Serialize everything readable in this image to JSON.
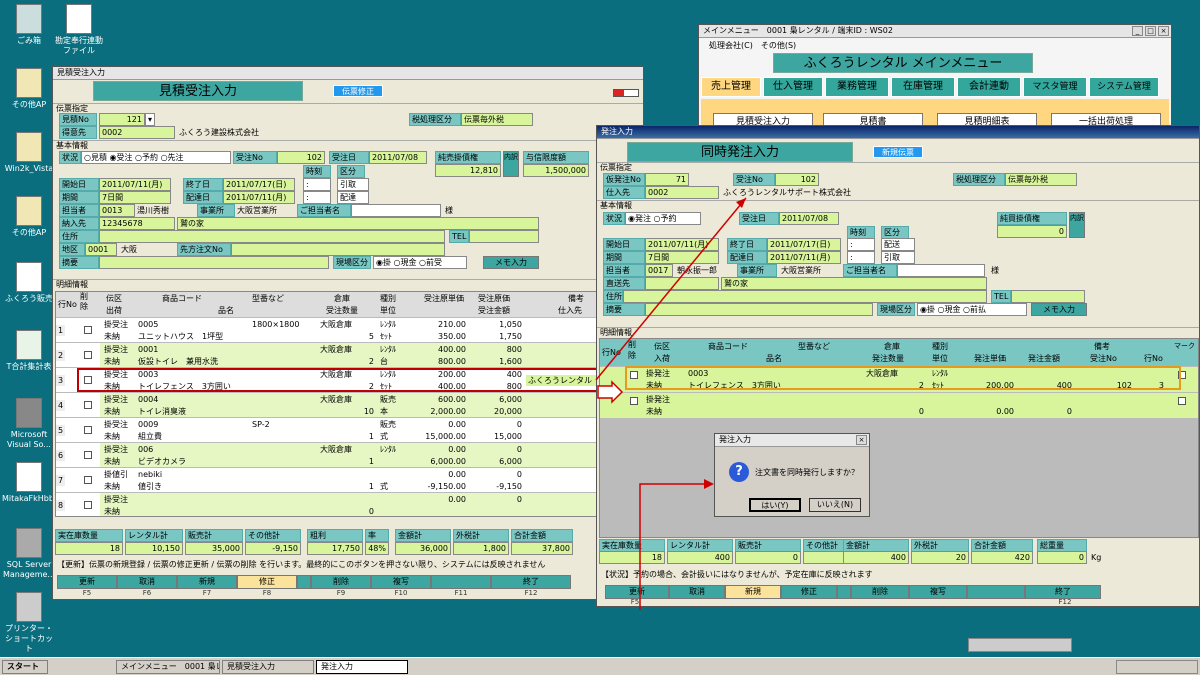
{
  "desktop": {
    "icons": [
      "ごみ箱",
      "勘定奉行連動ファイル",
      "その他AP",
      "Win2k_Vista",
      "その他AP",
      "ふくろう販売",
      "T合計集計表",
      "Microsoft Visual So...",
      "MitakaFkHbb...",
      "SQL Server Manageme...",
      "プリンター・ショートカット"
    ]
  },
  "est": {
    "title": "見積受注入力",
    "header": "見積受注入力",
    "badge": "伝票修正",
    "sec_denpyo": "伝票指定",
    "sec_kihon": "基本情報",
    "sec_meisai": "明細情報",
    "l_mitsumori": "見積No",
    "v_mitsumori": "121",
    "l_tokui": "得意先",
    "v_tokui_code": "0002",
    "v_tokui_name": "ふくろう建設株式会社",
    "l_zei": "税処理区分",
    "v_zei": "伝票毎外税",
    "l_jokyo": "状況",
    "jokyo_opts": "○見積 ◉受注 ○予約 ○先注",
    "l_juchu": "受注No",
    "v_juchu": "102",
    "l_juchubi": "受注日",
    "v_juchubi": "2011/07/08",
    "l_urikake": "純売掛債権",
    "v_urikake": "12,810",
    "btn_uchi": "内訳",
    "l_yoshin": "与信限度額",
    "v_yoshin": "1,500,000",
    "l_jikoku": "時刻",
    "l_kubun": "区分",
    "l_kaishi": "開始日",
    "v_kaishi": "2011/07/11(月)",
    "l_shuryo": "終了日",
    "v_shuryo": "2011/07/17(日)",
    "v_k1": "引取",
    "l_kikan": "期間",
    "v_kikan": "7日間",
    "l_haitatsu": "配達日",
    "v_haitatsu": "2011/07/11(月)",
    "v_k2": "配達",
    "l_tanto": "担当者",
    "v_tanto_code": "0013",
    "v_tanto_name": "湯川秀樹",
    "l_jigyo": "事業所",
    "v_jigyo": "大阪営業所",
    "l_gotanto": "ご担当者名",
    "v_sama": "様",
    "l_nonyu": "納入先",
    "v_nonyu_code": "12345678",
    "v_nonyu_name": "鷲の家",
    "l_jusho": "住所",
    "l_tel": "TEL",
    "l_chiku": "地区",
    "v_chiku_code": "0001",
    "v_chiku": "大阪",
    "l_saki": "先方注文No",
    "l_tekiyo": "摘要",
    "l_genba": "現場区分",
    "genba_opts": "◉掛 ○現金 ○前受",
    "btn_memo": "メモ入力",
    "cols": {
      "gyo": "行No",
      "sakujo": "削除",
      "denku": "伝区",
      "shoka": "出荷",
      "code": "商品コード",
      "hinmei": "品名",
      "kata": "型番など",
      "soko": "倉庫",
      "suryo": "受注数量",
      "shubetsu": "種別",
      "tani": "単位",
      "tanka": "受注原単価",
      "kin": "受注原価",
      "kingaku": "受注金額",
      "biko": "備考",
      "shiire": "仕入先"
    },
    "rows": [
      {
        "no": "1",
        "denku": "掛受注",
        "shoka": "未納",
        "code": "0005",
        "hinmei": "ユニットハウス　1坪型",
        "kata": "1800×1800",
        "soko": "大阪倉庫",
        "suryo": "5",
        "shubetsu": "ﾚﾝﾀﾙ",
        "tani": "ｾｯﾄ",
        "tanka1": "210.00",
        "tanka2": "350.00",
        "kin1": "1,050",
        "kin2": "1,750",
        "biko": ""
      },
      {
        "no": "2",
        "denku": "掛受注",
        "shoka": "未納",
        "code": "0001",
        "hinmei": "仮設トイレ　兼用水洗",
        "kata": "",
        "soko": "大阪倉庫",
        "suryo": "2",
        "shubetsu": "ﾚﾝﾀﾙ",
        "tani": "台",
        "tanka1": "400.00",
        "tanka2": "800.00",
        "kin1": "800",
        "kin2": "1,600",
        "biko": ""
      },
      {
        "no": "3",
        "denku": "掛受注",
        "shoka": "未納",
        "code": "0003",
        "hinmei": "トイレフェンス　3方囲い",
        "kata": "",
        "soko": "大阪倉庫",
        "suryo": "2",
        "shubetsu": "ﾚﾝﾀﾙ",
        "tani": "ｾｯﾄ",
        "tanka1": "200.00",
        "tanka2": "400.00",
        "kin1": "400",
        "kin2": "800",
        "biko": "ふくろうレンタル"
      },
      {
        "no": "4",
        "denku": "掛受注",
        "shoka": "未納",
        "code": "0004",
        "hinmei": "トイレ消臭液",
        "kata": "",
        "soko": "大阪倉庫",
        "suryo": "10",
        "shubetsu": "販売",
        "tani": "本",
        "tanka1": "600.00",
        "tanka2": "2,000.00",
        "kin1": "6,000",
        "kin2": "20,000",
        "biko": ""
      },
      {
        "no": "5",
        "denku": "掛受注",
        "shoka": "未納",
        "code": "0009",
        "hinmei": "組立費",
        "kata": "SP-2",
        "soko": "",
        "suryo": "1",
        "shubetsu": "販売",
        "tani": "式",
        "tanka1": "0.00",
        "tanka2": "15,000.00",
        "kin1": "0",
        "kin2": "15,000",
        "biko": ""
      },
      {
        "no": "6",
        "denku": "掛受注",
        "shoka": "未納",
        "code": "006",
        "hinmei": "ビデオカメラ",
        "kata": "",
        "soko": "大阪倉庫",
        "suryo": "1",
        "shubetsu": "ﾚﾝﾀﾙ",
        "tani": "",
        "tanka1": "0.00",
        "tanka2": "6,000.00",
        "kin1": "0",
        "kin2": "6,000",
        "biko": ""
      },
      {
        "no": "7",
        "denku": "掛値引",
        "shoka": "未納",
        "code": "nebiki",
        "hinmei": "値引き",
        "kata": "",
        "soko": "",
        "suryo": "1",
        "shubetsu": "",
        "tani": "式",
        "tanka1": "0.00",
        "tanka2": "-9,150.00",
        "kin1": "0",
        "kin2": "-9,150",
        "biko": ""
      },
      {
        "no": "8",
        "denku": "掛受注",
        "shoka": "未納",
        "code": "",
        "hinmei": "",
        "kata": "",
        "soko": "",
        "suryo": "0",
        "shubetsu": "",
        "tani": "",
        "tanka1": "0.00",
        "tanka2": "",
        "kin1": "0",
        "kin2": "",
        "biko": ""
      }
    ],
    "totals": {
      "l_zaiko": "実在庫数量",
      "v_zaiko": "18",
      "l_rental": "レンタル計",
      "v_rental": "10,150",
      "l_hanbai": "販売計",
      "v_hanbai": "35,000",
      "l_sonota": "その他計",
      "v_sonota": "-9,150",
      "l_arari": "粗利",
      "v_arari": "17,750",
      "l_ritsu": "率",
      "v_ritsu": "48%",
      "l_kingaku": "金額計",
      "v_kingaku": "36,000",
      "l_gaizei": "外税計",
      "v_gaizei": "1,800",
      "l_gokei": "合計金額",
      "v_gokei": "37,800"
    },
    "msg": "【更新】伝票の新規登録 / 伝票の修正更新 / 伝票の削除 を行います。最終的にこのボタンを押さない限り、システムには反映されません",
    "fbtns": [
      "更新",
      "取消",
      "新規",
      "修正",
      "",
      "削除",
      "複写",
      "",
      "終了"
    ],
    "fkeys": [
      "F5",
      "F6",
      "F7",
      "F8",
      "F9",
      "F10",
      "F11",
      "F12"
    ]
  },
  "menu": {
    "title": "メインメニュー　0001 梟レンタル / 端末ID : WS02",
    "menubar": "処理会社(C)　その他(S)",
    "header": "ふくろうレンタル メインメニュー",
    "tabs": [
      "売上管理",
      "仕入管理",
      "業務管理",
      "在庫管理",
      "会計連動",
      "マスタ管理",
      "システム管理"
    ],
    "buttons": [
      "見積受注入力",
      "見積書",
      "見積明細表",
      "一括出荷処理"
    ]
  },
  "order": {
    "title": "発注入力",
    "header": "同時発注入力",
    "badge": "新規伝票",
    "sec_denpyo": "伝票指定",
    "sec_kihon": "基本情報",
    "sec_meisai": "明細情報",
    "l_kari": "仮発注No",
    "v_kari": "71",
    "l_juchu": "受注No",
    "v_juchu": "102",
    "l_zei": "税処理区分",
    "v_zei": "伝票毎外税",
    "l_shiire": "仕入先",
    "v_shiire_code": "0002",
    "v_shiire_name": "ふくろうレンタルサポート株式会社",
    "l_jokyo": "状況",
    "jokyo_opts": "◉発注 ○予約",
    "l_juchubi": "受注日",
    "v_juchubi": "2011/07/08",
    "l_kaikake": "純買掛債権",
    "v_kaikake": "0",
    "btn_uchi": "内訳",
    "l_jikoku": "時刻",
    "l_kubun": "区分",
    "l_kaishi": "開始日",
    "v_kaishi": "2011/07/11(月)",
    "l_shuryo": "終了日",
    "v_shuryo": "2011/07/17(日)",
    "v_k1": "配送",
    "l_kikan": "期間",
    "v_kikan": "7日間",
    "l_haitatsu": "配達日",
    "v_haitatsu": "2011/07/11(月)",
    "v_k2": "引取",
    "l_tanto": "担当者",
    "v_tanto_code": "0017",
    "v_tanto_name": "朝永振一郎",
    "l_jigyo": "事業所",
    "v_jigyo": "大阪営業所",
    "l_gotanto": "ご担当者名",
    "v_sama": "様",
    "l_chokuso": "直送先",
    "v_chokuso": "鷲の家",
    "l_jusho": "住所",
    "l_tel": "TEL",
    "l_tekiyo": "摘要",
    "l_genba": "現場区分",
    "genba_opts": "◉掛 ○現金 ○前払",
    "btn_memo": "メモ入力",
    "cols": {
      "gyo": "行No",
      "sakujo": "削除",
      "denku": "伝区",
      "nyuka": "入荷",
      "code": "商品コード",
      "kata": "型番など",
      "hinmei": "品名",
      "soko": "倉庫",
      "suryo": "発注数量",
      "shubetsu": "種別",
      "tani": "単位",
      "tanka": "発注単価",
      "kingaku": "発注金額",
      "biko": "備考",
      "juchu": "受注No",
      "gyono": "行No",
      "mark": "マーク"
    },
    "rows": [
      {
        "denku": "掛発注",
        "nyuka": "未納",
        "code": "0003",
        "hinmei": "トイレフェンス　3方囲い",
        "soko": "大阪倉庫",
        "suryo": "2",
        "shubetsu": "ﾚﾝﾀﾙ",
        "tani": "ｾｯﾄ",
        "tanka": "200.00",
        "kingaku": "400",
        "juchu": "102",
        "gyono": "3"
      },
      {
        "denku": "掛発注",
        "nyuka": "未納",
        "code": "",
        "hinmei": "",
        "soko": "",
        "suryo": "0",
        "shubetsu": "",
        "tani": "",
        "tanka": "0.00",
        "kingaku": "0",
        "juchu": "",
        "gyono": ""
      }
    ],
    "totals": {
      "l_zaiko": "実在庫数量",
      "v_zaiko": "18",
      "l_rental": "レンタル計",
      "v_rental": "400",
      "l_hanbai": "販売計",
      "v_hanbai": "0",
      "l_sonota": "その他計",
      "v_sonota": "0",
      "l_kingaku": "金額計",
      "v_kingaku": "400",
      "l_gaizei": "外税計",
      "v_gaizei": "20",
      "l_gokei": "合計金額",
      "v_gokei": "420",
      "l_soju": "総重量",
      "v_soju": "0",
      "v_kg": "Kg"
    },
    "msg": "【状況】予約の場合、会計扱いにはなりませんが、予定在庫に反映されます",
    "fbtns": [
      "更新",
      "取消",
      "新規",
      "修正",
      "",
      "削除",
      "複写",
      "",
      "終了"
    ],
    "fkeys": [
      "F5",
      "F12"
    ]
  },
  "dialog": {
    "title": "発注入力",
    "message": "注文書を同時発行しますか？",
    "yes": "はい(Y)",
    "no": "いいえ(N)"
  },
  "taskbar": {
    "start": "スタート",
    "tasks": [
      "メインメニュー　0001 梟レ",
      "見積受注入力",
      "発注入力"
    ]
  },
  "colors": {
    "desktop": "#0a6e7e",
    "teal": "#3ea6a0",
    "label": "#7ac6c3",
    "green_field": "#d8f59c",
    "highlight_red": "#c00000",
    "orange": "#e89a1a"
  }
}
